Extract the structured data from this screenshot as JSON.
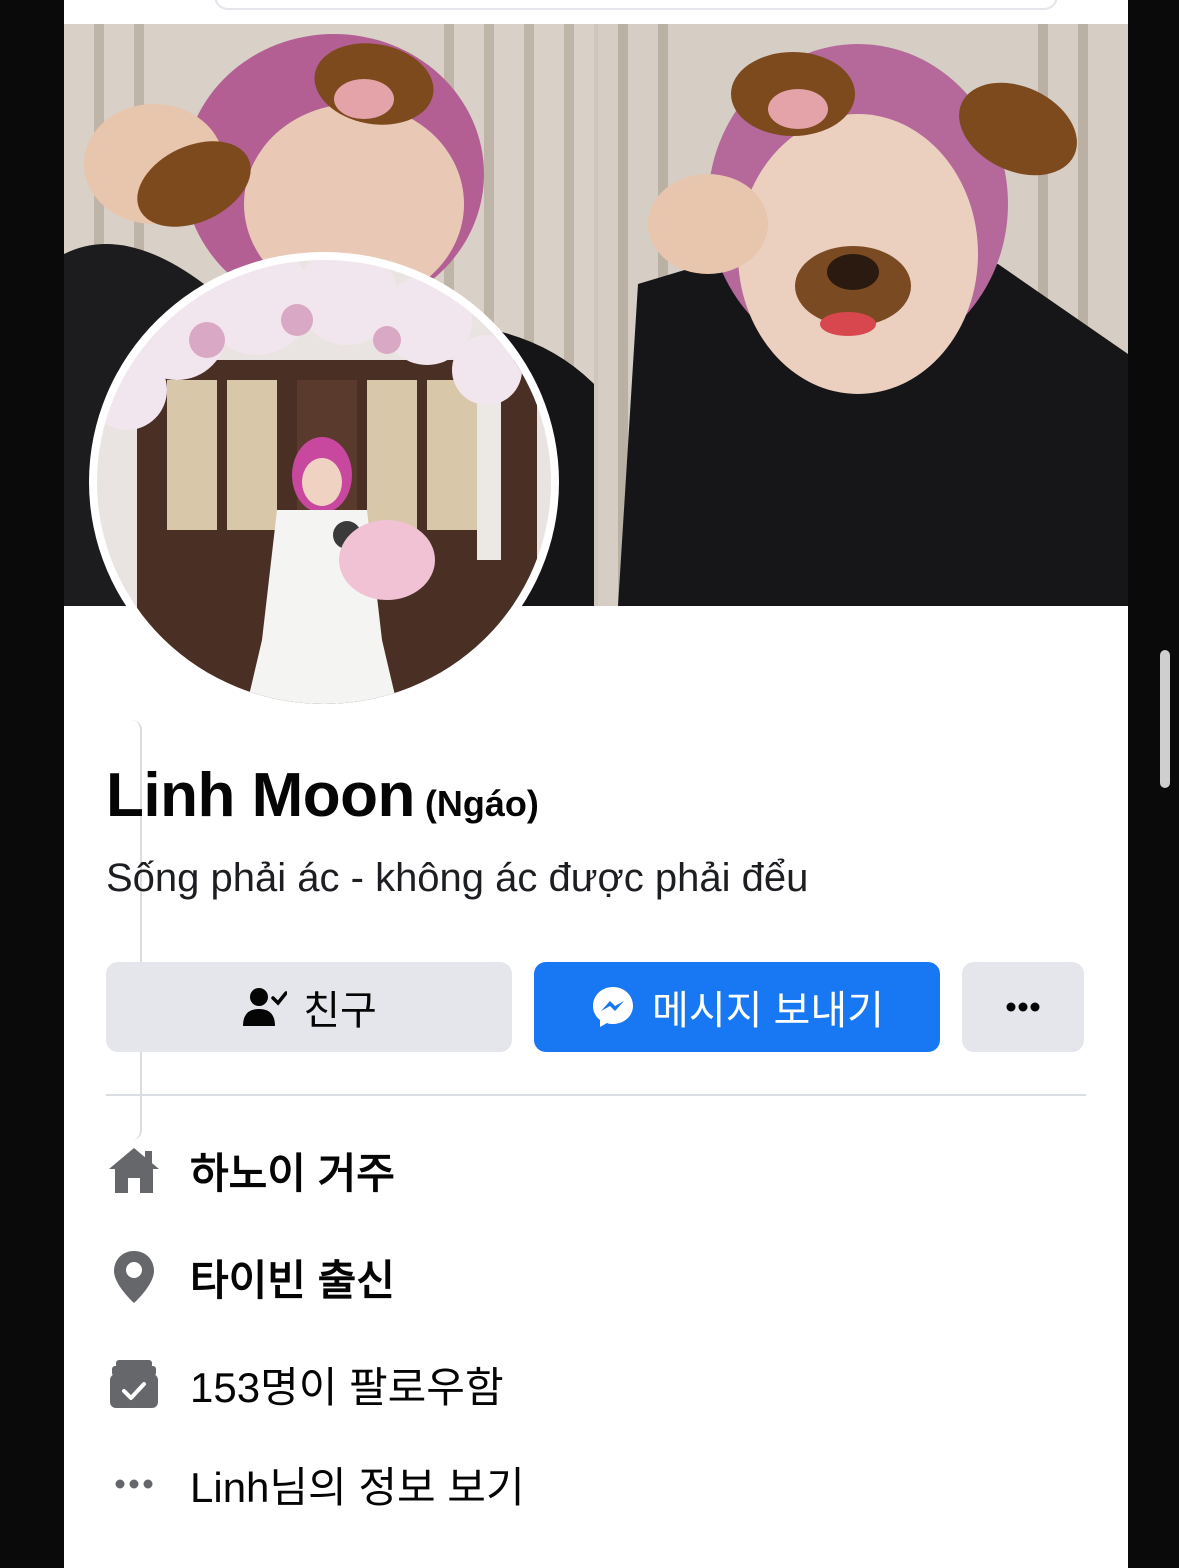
{
  "profile": {
    "name": "Linh Moon",
    "nickname": "(Ngáo)",
    "bio": "Sống phải ác - không ác được phải đểu"
  },
  "actions": {
    "friend_label": "친구",
    "message_label": "메시지 보내기",
    "more_label": "···"
  },
  "details": [
    {
      "icon": "home-icon",
      "text": "하노이 거주"
    },
    {
      "icon": "location-pin-icon",
      "text": "타이빈 출신"
    },
    {
      "icon": "followers-icon",
      "text": "153명이 팔로우함"
    },
    {
      "icon": "more-dots-icon",
      "text": "Linh님의 정보 보기"
    }
  ],
  "colors": {
    "accent": "#1877f2",
    "button_gray": "#e4e6eb",
    "icon_gray": "#65676b"
  }
}
